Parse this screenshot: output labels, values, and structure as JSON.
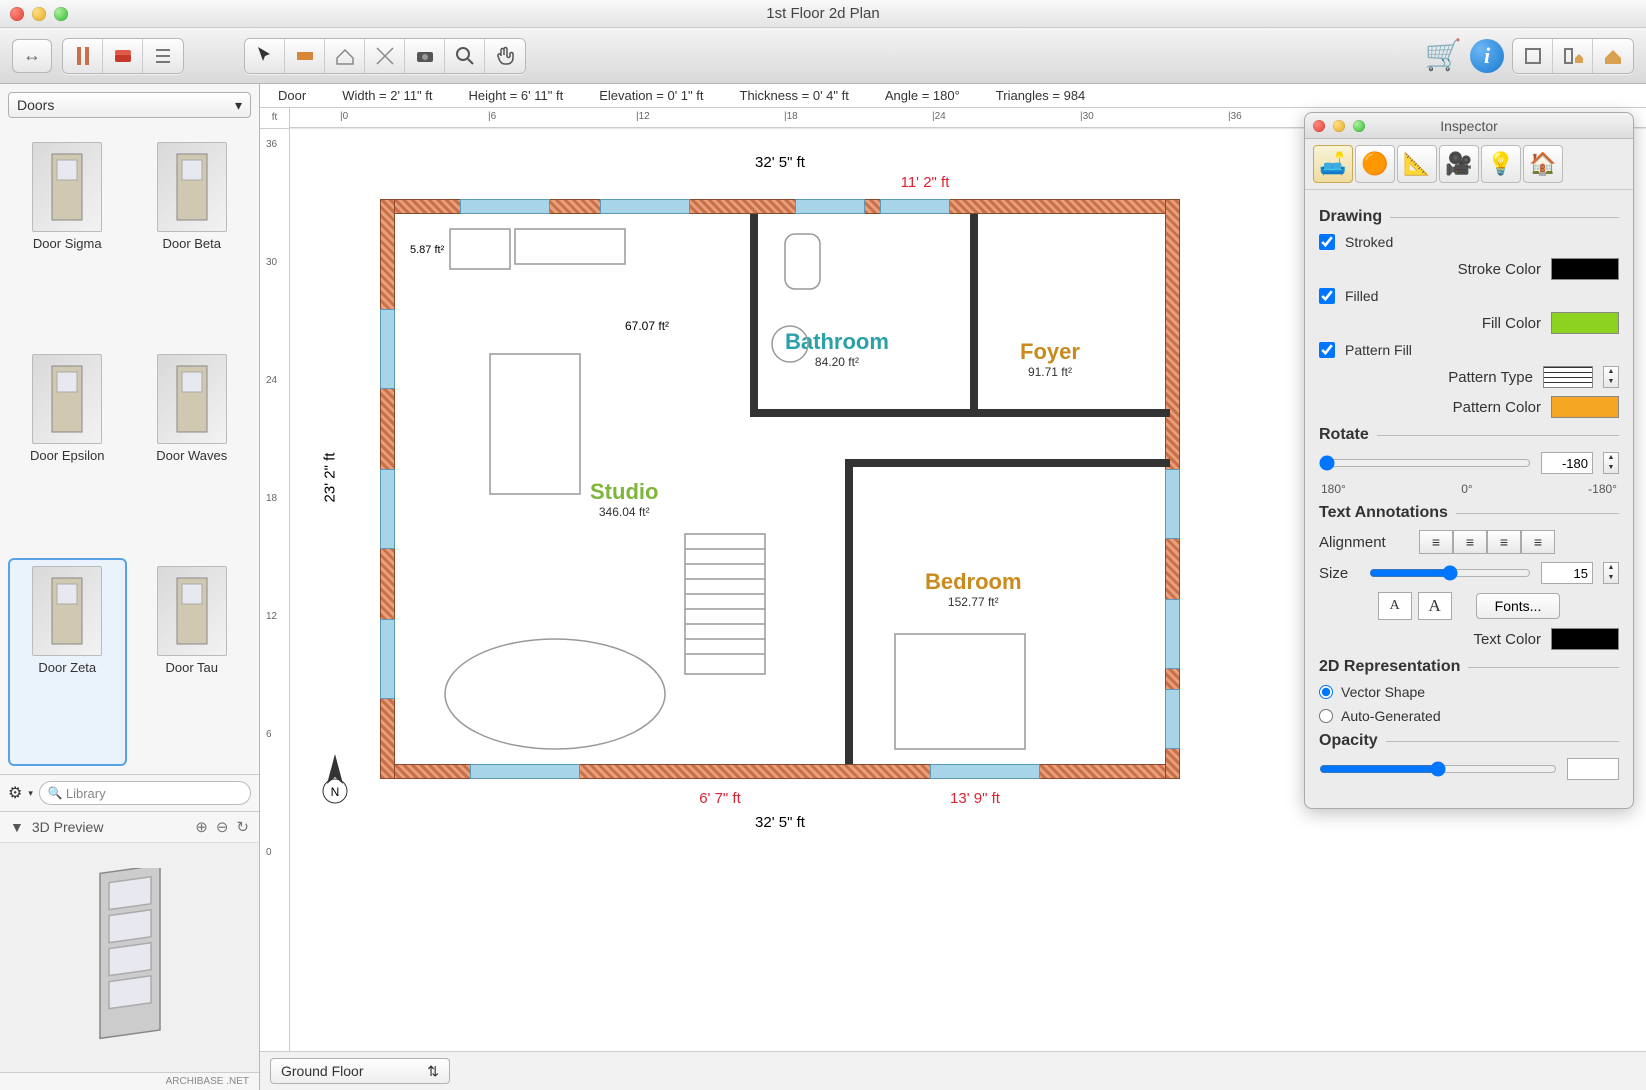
{
  "window": {
    "title": "1st Floor 2d Plan"
  },
  "infobar": {
    "object": "Door",
    "width": "Width = 2' 11\" ft",
    "height": "Height = 6' 11\" ft",
    "elevation": "Elevation = 0' 1\" ft",
    "thickness": "Thickness = 0' 4\" ft",
    "angle": "Angle = 180°",
    "triangles": "Triangles = 984"
  },
  "ruler_unit": "ft",
  "ruler_h": [
    "|0",
    "|6",
    "|12",
    "|18",
    "|24",
    "|30",
    "|36"
  ],
  "ruler_v": [
    "36",
    "30",
    "24",
    "18",
    "12",
    "6",
    "0"
  ],
  "sidebar": {
    "category": "Doors",
    "items": [
      {
        "label": "Door Sigma"
      },
      {
        "label": "Door Beta"
      },
      {
        "label": "Door Epsilon"
      },
      {
        "label": "Door Waves"
      },
      {
        "label": "Door Zeta"
      },
      {
        "label": "Door Tau"
      }
    ],
    "selected_index": 4,
    "search_placeholder": "Library",
    "preview_title": "3D Preview",
    "logo": "ARCHIBASE .NET"
  },
  "floor_select": "Ground Floor",
  "plan": {
    "overall_w": "32' 5\" ft",
    "overall_h": "23' 2\" ft",
    "dim_top_right": "11' 2\" ft",
    "dim_bottom_left": "6' 7\" ft",
    "dim_bottom_right": "13' 9\" ft",
    "rooms": {
      "studio": {
        "name": "Studio",
        "area": "346.04 ft²",
        "color": "#7eb53a",
        "small_area": "67.07 ft²",
        "closet_area": "5.87 ft²"
      },
      "bathroom": {
        "name": "Bathroom",
        "area": "84.20 ft²",
        "color": "#2aa1a8"
      },
      "foyer": {
        "name": "Foyer",
        "area": "91.71 ft²",
        "color": "#c98a1e"
      },
      "bedroom": {
        "name": "Bedroom",
        "area": "152.77 ft²",
        "color": "#c98a1e"
      }
    }
  },
  "inspector": {
    "title": "Inspector",
    "drawing": {
      "section": "Drawing",
      "stroked_label": "Stroked",
      "stroked": true,
      "stroke_color_label": "Stroke Color",
      "stroke_color": "#000000",
      "filled_label": "Filled",
      "filled": true,
      "fill_color_label": "Fill Color",
      "fill_color": "#8cd21f",
      "pattern_fill_label": "Pattern Fill",
      "pattern_fill": true,
      "pattern_type_label": "Pattern Type",
      "pattern_color_label": "Pattern Color",
      "pattern_color": "#f5a623"
    },
    "rotate": {
      "label": "Rotate",
      "value": "-180",
      "ticks": [
        "180°",
        "0°",
        "-180°"
      ]
    },
    "text": {
      "section": "Text Annotations",
      "alignment_label": "Alignment",
      "size_label": "Size",
      "size_value": "15",
      "fonts_btn": "Fonts...",
      "text_color_label": "Text Color",
      "text_color": "#000000"
    },
    "rep2d": {
      "section": "2D Representation",
      "vector_label": "Vector Shape",
      "auto_label": "Auto-Generated",
      "selected": "vector"
    },
    "opacity": {
      "label": "Opacity",
      "value": ""
    }
  }
}
